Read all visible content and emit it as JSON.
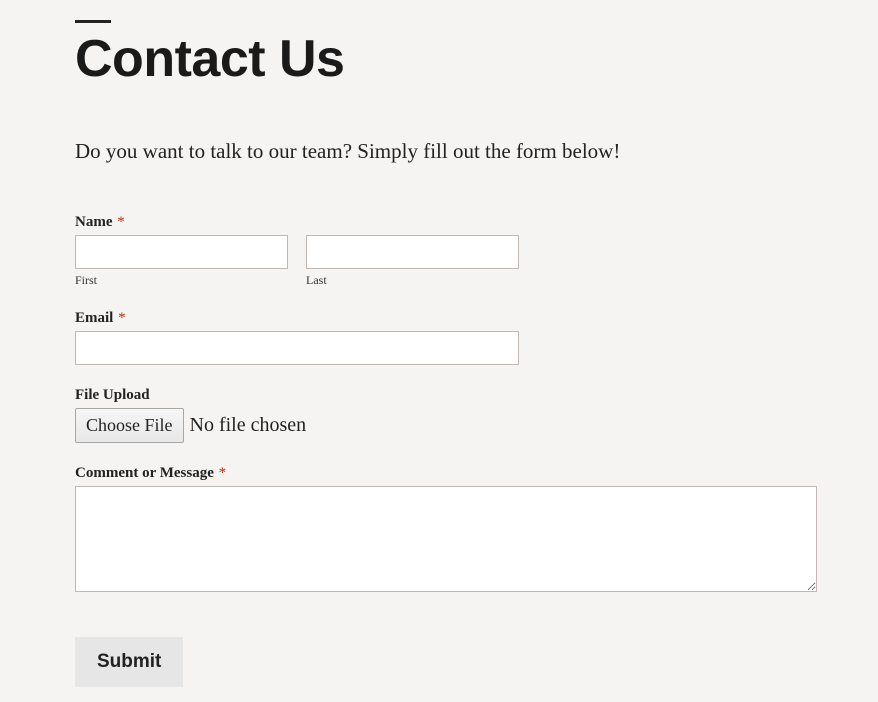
{
  "page": {
    "title": "Contact Us",
    "intro": "Do you want to talk to our team? Simply fill out the form below!"
  },
  "form": {
    "name": {
      "label": "Name",
      "required_marker": "*",
      "first_sublabel": "First",
      "last_sublabel": "Last",
      "first_value": "",
      "last_value": ""
    },
    "email": {
      "label": "Email",
      "required_marker": "*",
      "value": ""
    },
    "file": {
      "label": "File Upload",
      "button_label": "Choose File",
      "status": "No file chosen"
    },
    "message": {
      "label": "Comment or Message",
      "required_marker": "*",
      "value": ""
    },
    "submit_label": "Submit"
  }
}
